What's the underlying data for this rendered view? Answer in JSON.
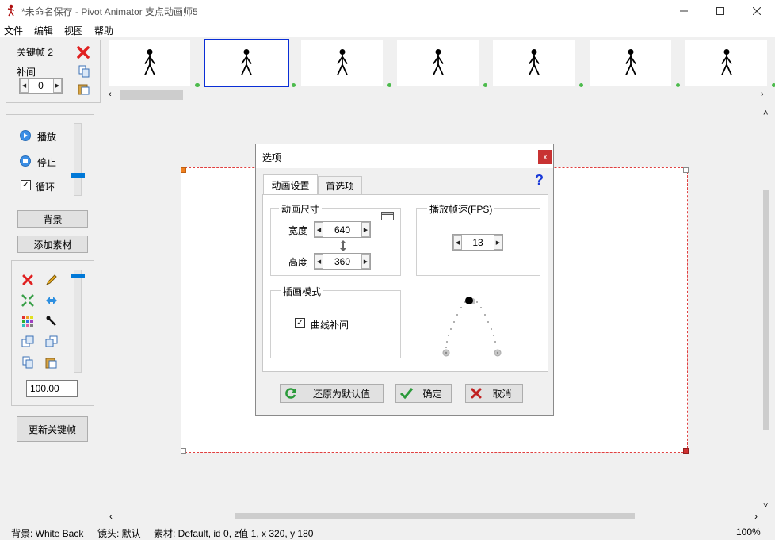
{
  "window": {
    "title": "*未命名保存 - Pivot Animator 支点动画师5"
  },
  "menu": [
    {
      "label": "文件"
    },
    {
      "label": "编辑"
    },
    {
      "label": "视图"
    },
    {
      "label": "帮助"
    }
  ],
  "keyframe_panel": {
    "keyframe_label": "关键帧 2",
    "tween_label": "补间",
    "tween_value": "0"
  },
  "playback": {
    "play_label": "播放",
    "stop_label": "停止",
    "loop_label": "循环",
    "loop_checked": true
  },
  "buttons": {
    "background": "背景",
    "add_asset": "添加素材",
    "update_keyframe": "更新关键帧"
  },
  "scale_value": "100.00",
  "dialog": {
    "title": "选项",
    "close": "x",
    "help": "?",
    "tabs": [
      {
        "label": "动画设置",
        "active": true
      },
      {
        "label": "首选项",
        "active": false
      }
    ],
    "size_group": {
      "title": "动画尺寸",
      "width_label": "宽度",
      "width_value": "640",
      "height_label": "高度",
      "height_value": "360"
    },
    "fps_group": {
      "title": "播放帧速(FPS)",
      "value": "13"
    },
    "interp_group": {
      "title": "插画模式",
      "curve_label": "曲线补间",
      "curve_checked": true
    },
    "footer": {
      "reset": "还原为默认值",
      "ok": "确定",
      "cancel": "取消"
    }
  },
  "status": {
    "background": "背景: White Back",
    "camera": "镜头: 默认",
    "asset": "素材: Default,  id 0,  z值 1,  x 320, y 180",
    "zoom": "100%"
  },
  "colors": {
    "selection_border": "#0a2ed6",
    "stage_border": "#e04040",
    "accent": "#0078d7",
    "frame_dot": "#4cbb4c"
  }
}
